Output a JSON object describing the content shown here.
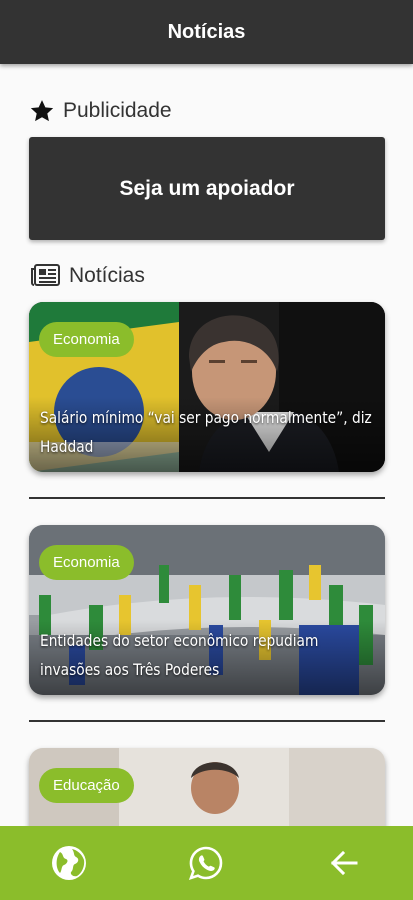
{
  "appbar": {
    "title": "Notícias"
  },
  "ad_section": {
    "title": "Publicidade",
    "icon": "star-icon",
    "banner_label": "Seja um apoiador"
  },
  "news_section": {
    "title": "Notícias",
    "icon": "newspaper-icon"
  },
  "articles": [
    {
      "category": "Economia",
      "title": "Salário mínimo “vai ser pago normalmente”, diz Haddad"
    },
    {
      "category": "Economia",
      "title": "Entidades do setor econômico repudiam invasões aos Três Poderes"
    },
    {
      "category": "Educação",
      "title": ""
    }
  ],
  "bottom_nav": {
    "items": [
      "globe-icon",
      "whatsapp-icon",
      "back-arrow-icon"
    ]
  },
  "colors": {
    "appbar": "#333333",
    "accent": "#8bbd2b",
    "background": "#fafafa"
  }
}
